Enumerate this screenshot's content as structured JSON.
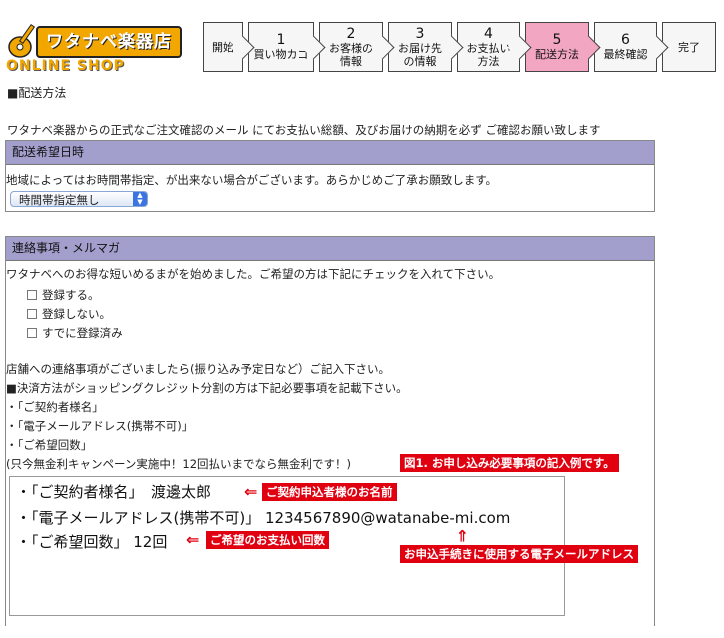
{
  "logo": {
    "main": "ワタナベ楽器店",
    "sub": "ONLINE SHOP"
  },
  "steps": [
    {
      "num": "",
      "label": "開始"
    },
    {
      "num": "1",
      "label": "買い物カゴ"
    },
    {
      "num": "2",
      "label": "お客様の\n情報"
    },
    {
      "num": "3",
      "label": "お届け先\nの情報"
    },
    {
      "num": "4",
      "label": "お支払い\n方法"
    },
    {
      "num": "5",
      "label": "配送方法"
    },
    {
      "num": "6",
      "label": "最終確認"
    },
    {
      "num": "",
      "label": "完了"
    }
  ],
  "section_title": "■配送方法",
  "notice": "ワタナベ楽器からの正式なご注文確認のメール にてお支払い総額、及びお届けの納期を必ず ご確認お願い致します",
  "delivery": {
    "header": "配送希望日時",
    "text": "地域によってはお時間帯指定、が出来ない場合がございます。あらかじめご了承お願致します。",
    "select_value": "時間帯指定無し"
  },
  "contact": {
    "header": "連絡事項・メルマガ",
    "intro": "ワタナベへのお得な短いめるまがを始めました。ご希望の方は下記にチェックを入れて下さい。",
    "options": [
      "登録する。",
      "登録しない。",
      "すでに登録済み"
    ],
    "lines": [
      "店舗への連絡事項がございましたら(振り込み予定日など）ご記入下さい。",
      "■決済方法がショッピングクレジット分割の方は下記必要事項を記載下さい。",
      "・「ご契約者様名」",
      "・「電子メールアドレス(携帯不可)」",
      "・「ご希望回数」",
      "(只今無金利キャンペーン実施中！12回払いまでなら無金利です！)"
    ],
    "textarea_lines": [
      "・「ご契約者様名」　渡邊太郎",
      "・「電子メールアドレス(携帯不可)」 1234567890@watanabe-mi.com",
      "・「ご希望回数」 12回"
    ]
  },
  "annotations": {
    "figure": "図1. お申し込み必要事項の記入例です。",
    "name": "ご契約申込者様のお名前",
    "email": "お申込手続きに使用する電子メールアドレス",
    "count": "ご希望のお支払い回数"
  },
  "colors": {
    "accent": "#f3a6c2",
    "panel_header": "#a29fcd",
    "annotation": "#e00010",
    "logo": "#f2a600"
  }
}
